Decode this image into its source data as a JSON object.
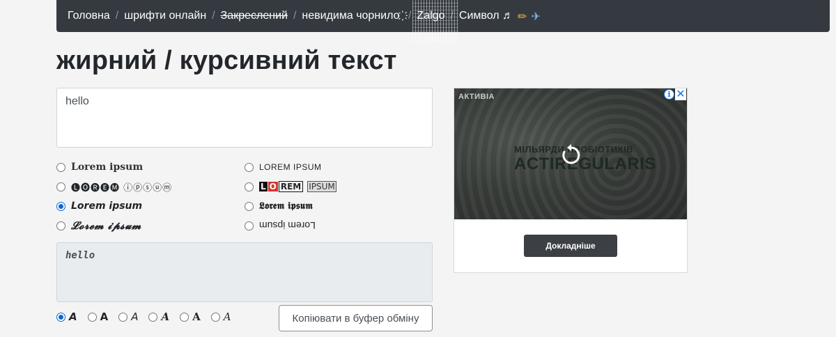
{
  "nav": {
    "items": [
      {
        "label": "Головна"
      },
      {
        "label": "шрифти онлайн"
      },
      {
        "label": "Закреслений"
      },
      {
        "label": "невидима чорнило ҉"
      },
      {
        "label": "Zalgo"
      },
      {
        "label": "Символ ♬"
      }
    ],
    "separator": "/",
    "emoji_pencil": "✏",
    "emoji_plane": "✈"
  },
  "page_title": "жирний / курсивний текст",
  "input": {
    "value": "hello"
  },
  "font_options": [
    {
      "label": "Lorem ipsum",
      "checked": false
    },
    {
      "label": "LOREM IPSUM",
      "checked": false
    },
    {
      "label": "🅛🅞🅡🅔🅜 ⓘⓟⓢⓤⓜ",
      "checked": false
    },
    {
      "label_parts": [
        "L",
        "O",
        "REM",
        "IPSUM"
      ],
      "checked": false
    },
    {
      "label": "Lorem ipsum",
      "checked": true
    },
    {
      "label": "𝕷𝖔𝖗𝖊𝖒 𝖎𝖕𝖘𝖚𝖒",
      "checked": false
    },
    {
      "label": "𝓛𝓸𝓻𝓮𝓶 𝓲𝓹𝓼𝓾𝓶",
      "checked": false
    },
    {
      "label": "Lorem ipsum",
      "checked": false
    }
  ],
  "output": {
    "value": "hello"
  },
  "style_options": [
    {
      "label": "A",
      "checked": true
    },
    {
      "label": "A",
      "checked": false
    },
    {
      "label": "A",
      "checked": false
    },
    {
      "label": "A",
      "checked": false
    },
    {
      "label": "A",
      "checked": false
    },
    {
      "label": "A",
      "checked": false
    }
  ],
  "copy_button": "Копіювати в буфер обміну",
  "ad": {
    "brand": "АКТИВІА",
    "line1": "МІЛЬЯРДИ ПРОБІОТИКІВ",
    "line2": "ACTIREGULARIS",
    "button": "Докладніше",
    "info": "i",
    "close": "✕"
  }
}
